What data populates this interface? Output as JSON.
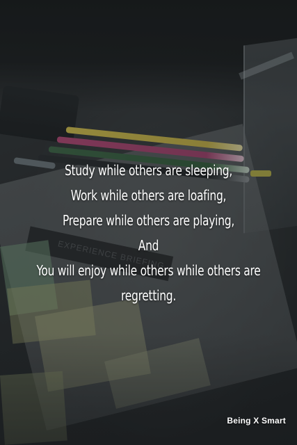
{
  "quote": {
    "lines": [
      "Study while others are sleeping,",
      "Work while others are loafing,",
      "Prepare while others are playing,",
      "And",
      "You will enjoy while others while others are",
      "regretting."
    ]
  },
  "brand": {
    "text": "Being X Smart"
  },
  "photo": {
    "background_text": "EXPERIENCE BRIEFING"
  }
}
